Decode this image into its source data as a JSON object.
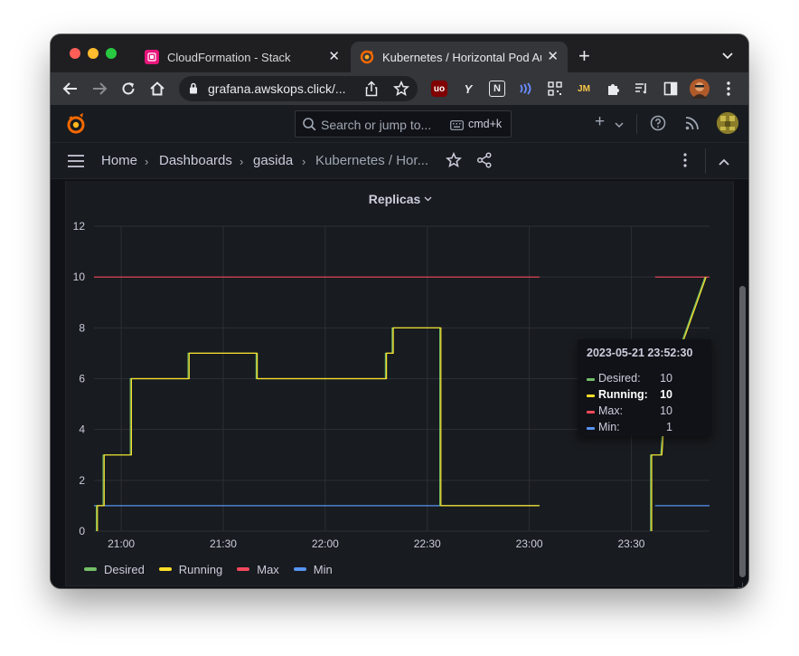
{
  "browser": {
    "tabs": [
      {
        "title": "CloudFormation - Stack",
        "active": false,
        "favicon": "cloudformation-icon"
      },
      {
        "title": "Kubernetes / Horizontal Pod Au",
        "active": true,
        "favicon": "grafana-icon"
      }
    ],
    "url": "grafana.awskops.click/..."
  },
  "grafana": {
    "search_placeholder": "Search or jump to...",
    "search_shortcut": "cmd+k",
    "breadcrumbs": [
      "Home",
      "Dashboards",
      "gasida",
      "Kubernetes / Hor..."
    ]
  },
  "panel": {
    "title": "Replicas",
    "tooltip": {
      "time": "2023-05-21 23:52:30",
      "rows": [
        {
          "label": "Desired:",
          "value": "10",
          "color": "#73bf69",
          "bold": false
        },
        {
          "label": "Running:",
          "value": "10",
          "color": "#fade2a",
          "bold": true
        },
        {
          "label": "Max:",
          "value": "10",
          "color": "#f2495c",
          "bold": false
        },
        {
          "label": "Min:",
          "value": "1",
          "color": "#5794f2",
          "bold": false
        }
      ]
    }
  },
  "colors": {
    "desired": "#73bf69",
    "running": "#fade2a",
    "max": "#f2495c",
    "min": "#5794f2",
    "background": "#181b1f",
    "grid": "#2c2f36"
  },
  "chart_data": {
    "type": "line",
    "title": "Replicas",
    "x_ticks": [
      "21:00",
      "21:30",
      "22:00",
      "22:30",
      "23:00",
      "23:30"
    ],
    "x_range": [
      "20:52",
      "23:53"
    ],
    "y_ticks": [
      0,
      2,
      4,
      6,
      8,
      10,
      12
    ],
    "ylim": [
      0,
      12
    ],
    "grid": true,
    "legend_position": "bottom-left",
    "series": [
      {
        "name": "Desired",
        "color": "#73bf69",
        "segments": [
          [
            [
              "20:53",
              0
            ],
            [
              "20:53",
              1
            ],
            [
              "20:55",
              1
            ],
            [
              "20:55",
              3
            ],
            [
              "20:59",
              3
            ],
            [
              "20:59",
              3
            ],
            [
              "21:03",
              3
            ],
            [
              "21:03",
              6
            ],
            [
              "21:18",
              6
            ],
            [
              "21:18",
              6
            ],
            [
              "21:20",
              6
            ],
            [
              "21:20",
              7
            ],
            [
              "21:30",
              7
            ],
            [
              "21:30",
              7
            ],
            [
              "21:40",
              7
            ],
            [
              "21:40",
              6
            ],
            [
              "22:18",
              6
            ],
            [
              "22:18",
              7
            ],
            [
              "22:20",
              7
            ],
            [
              "22:20",
              8
            ],
            [
              "22:30",
              8
            ],
            [
              "22:30",
              8
            ],
            [
              "22:34",
              8
            ],
            [
              "22:34",
              1
            ],
            [
              "23:03",
              1
            ]
          ],
          [
            [
              "23:36",
              0
            ],
            [
              "23:36",
              3
            ],
            [
              "23:38",
              3
            ],
            [
              "23:38",
              3
            ],
            [
              "23:39",
              3
            ],
            [
              "23:41",
              7
            ],
            [
              "23:44",
              7
            ],
            [
              "23:52",
              10
            ]
          ]
        ]
      },
      {
        "name": "Running",
        "color": "#fade2a",
        "segments": [
          [
            [
              "20:53",
              0
            ],
            [
              "20:53",
              1
            ],
            [
              "20:55",
              1
            ],
            [
              "20:55",
              3
            ],
            [
              "20:59",
              3
            ],
            [
              "20:59",
              3
            ],
            [
              "21:03",
              3
            ],
            [
              "21:03",
              6
            ],
            [
              "21:18",
              6
            ],
            [
              "21:18",
              6
            ],
            [
              "21:20",
              6
            ],
            [
              "21:20",
              7
            ],
            [
              "21:30",
              7
            ],
            [
              "21:30",
              7
            ],
            [
              "21:40",
              7
            ],
            [
              "21:40",
              6
            ],
            [
              "22:18",
              6
            ],
            [
              "22:18",
              7
            ],
            [
              "22:20",
              7
            ],
            [
              "22:20",
              8
            ],
            [
              "22:30",
              8
            ],
            [
              "22:30",
              8
            ],
            [
              "22:34",
              8
            ],
            [
              "22:34",
              1
            ],
            [
              "23:03",
              1
            ]
          ],
          [
            [
              "23:36",
              0
            ],
            [
              "23:36",
              3
            ],
            [
              "23:38",
              3
            ],
            [
              "23:38",
              3
            ],
            [
              "23:39",
              3
            ],
            [
              "23:41",
              7
            ],
            [
              "23:44",
              7
            ],
            [
              "23:52",
              10
            ]
          ]
        ]
      },
      {
        "name": "Max",
        "color": "#f2495c",
        "segments": [
          [
            [
              "20:52",
              10
            ],
            [
              "23:03",
              10
            ]
          ],
          [
            [
              "23:37",
              10
            ],
            [
              "23:53",
              10
            ]
          ]
        ]
      },
      {
        "name": "Min",
        "color": "#5794f2",
        "segments": [
          [
            [
              "20:52",
              1
            ],
            [
              "23:03",
              1
            ]
          ],
          [
            [
              "23:37",
              1
            ],
            [
              "23:53",
              1
            ]
          ]
        ]
      }
    ]
  }
}
